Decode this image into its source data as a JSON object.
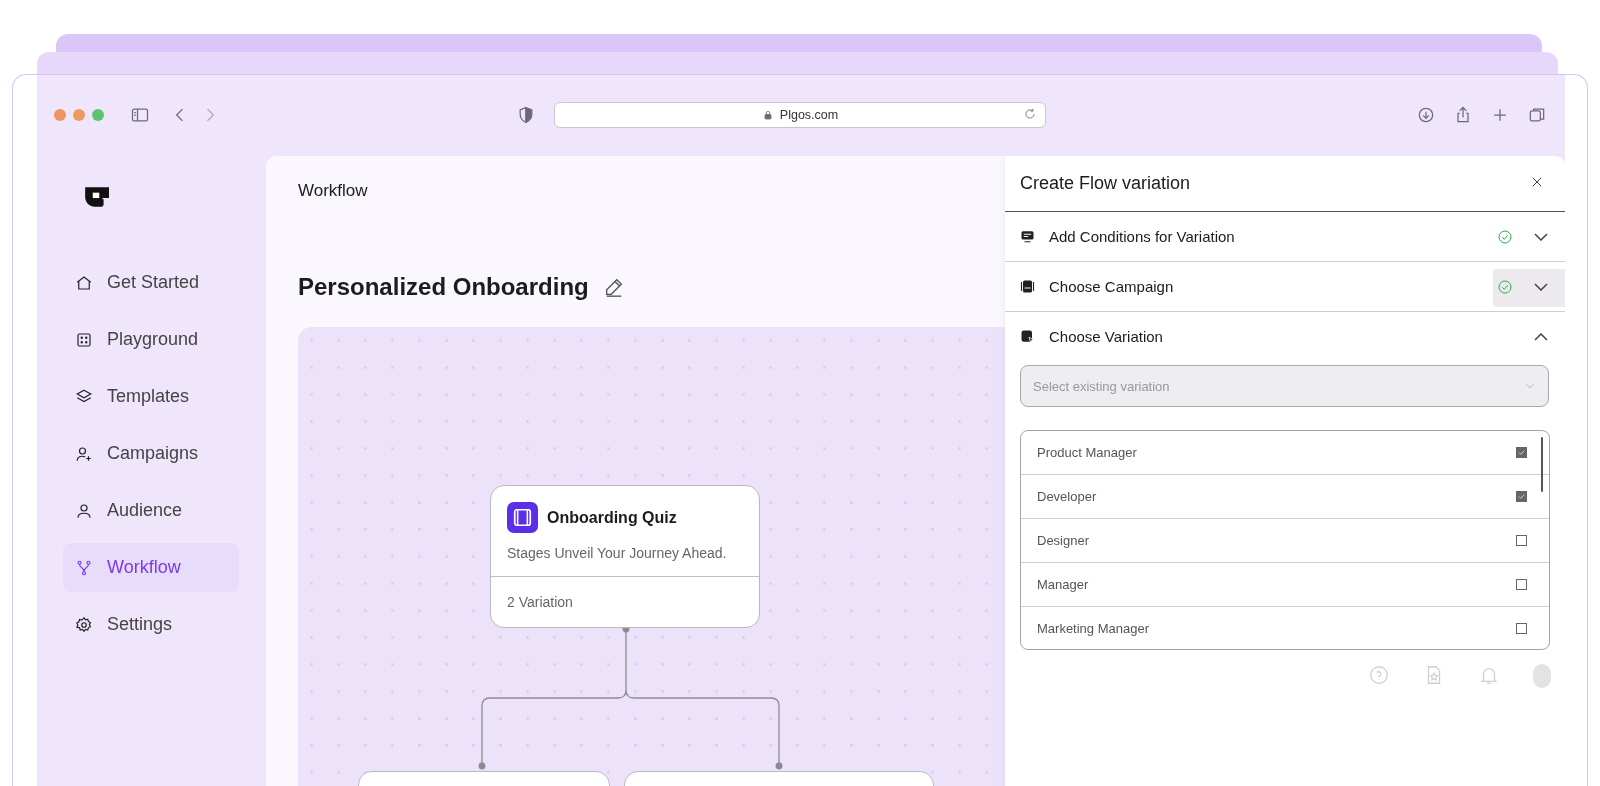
{
  "browser": {
    "url": "Plgos.com"
  },
  "sidebar": {
    "items": [
      {
        "label": "Get Started",
        "selected": false
      },
      {
        "label": "Playground",
        "selected": false
      },
      {
        "label": "Templates",
        "selected": false
      },
      {
        "label": "Campaigns",
        "selected": false
      },
      {
        "label": "Audience",
        "selected": false
      },
      {
        "label": "Workflow",
        "selected": true
      },
      {
        "label": "Settings",
        "selected": false
      }
    ]
  },
  "header": {
    "title": "Workflow"
  },
  "flow": {
    "title": "Personalized Onboarding",
    "node": {
      "title": "Onboarding Quiz",
      "subtitle": "Stages Unveil Your Journey Ahead.",
      "footer": "2 Variation"
    }
  },
  "drawer": {
    "title": "Create Flow variation",
    "sections": [
      {
        "label": "Add Conditions for Variation",
        "done": true,
        "expanded": false
      },
      {
        "label": "Choose Campaign",
        "done": true,
        "expanded": false
      },
      {
        "label": "Choose Variation",
        "done": false,
        "expanded": true
      }
    ],
    "select": {
      "placeholder": "Select existing variation"
    },
    "options": [
      {
        "label": "Product Manager",
        "checked": true
      },
      {
        "label": "Developer",
        "checked": true
      },
      {
        "label": "Designer",
        "checked": false
      },
      {
        "label": "Manager",
        "checked": false
      },
      {
        "label": "Marketing Manager",
        "checked": false
      }
    ]
  }
}
